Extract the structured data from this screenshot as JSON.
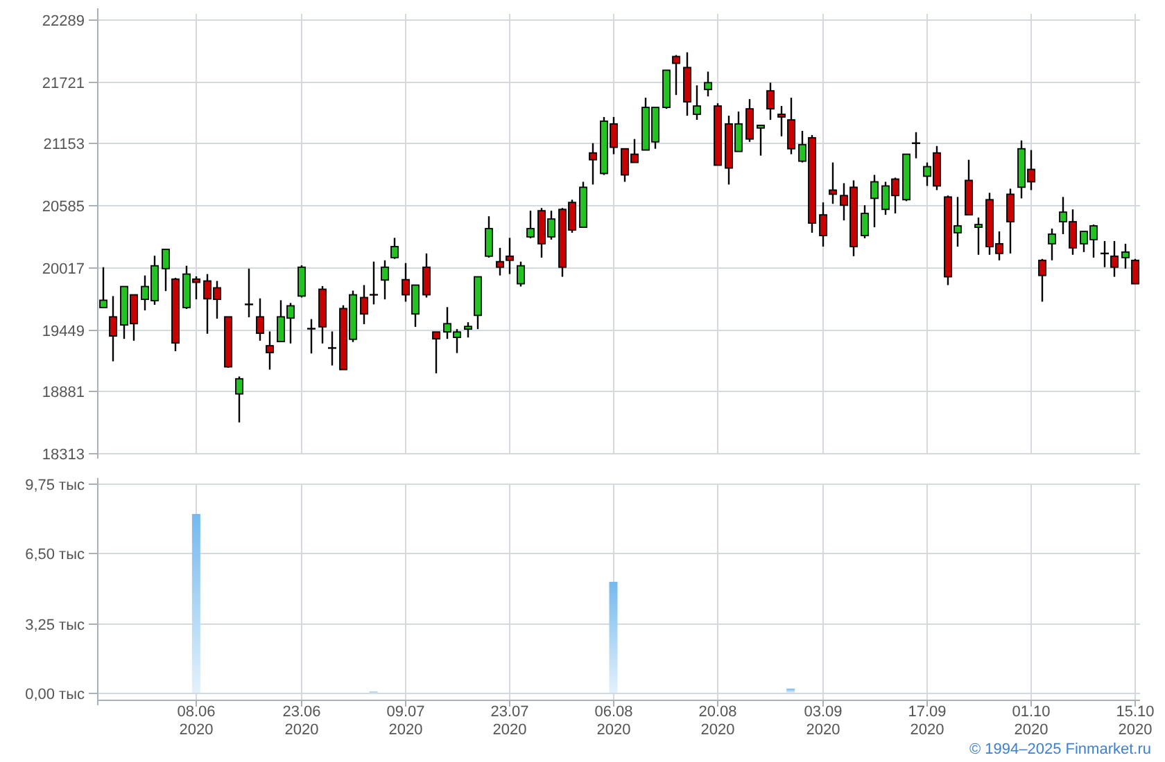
{
  "price_chart": {
    "chart_data": {
      "type": "candlestick",
      "grid": true,
      "categories": [
        null,
        null,
        null,
        null,
        null,
        null,
        null,
        null,
        null,
        null,
        null,
        null,
        null,
        null,
        null,
        null,
        null,
        null,
        null,
        null,
        null,
        null,
        null,
        null,
        null,
        null,
        null,
        null,
        null,
        null,
        null,
        null,
        null,
        null,
        null,
        null,
        null,
        null,
        null,
        null,
        null,
        null,
        null,
        null,
        null,
        null,
        null,
        null,
        null,
        null,
        null,
        null,
        null,
        null,
        null,
        null,
        null,
        null,
        null,
        null,
        null,
        null,
        null,
        null,
        null,
        null,
        null,
        null,
        null,
        null,
        null,
        null,
        null,
        null,
        null,
        null,
        null,
        null,
        null,
        null,
        null,
        null,
        null,
        null,
        null,
        null,
        null,
        null,
        null,
        null,
        null,
        null,
        null,
        null,
        null,
        null,
        null,
        null,
        null,
        null
      ],
      "ylim": [
        18313,
        22289
      ],
      "yticks": [
        18313,
        18881,
        19449,
        20017,
        20585,
        21153,
        21721,
        22289
      ],
      "ohlc": [
        [
          19647,
          20017,
          19647,
          19714
        ],
        [
          19562,
          19752,
          19154,
          19386
        ],
        [
          19487,
          19840,
          19360,
          19840
        ],
        [
          19764,
          19764,
          19343,
          19499
        ],
        [
          19722,
          19941,
          19621,
          19840
        ],
        [
          19710,
          20122,
          19672,
          20030
        ],
        [
          20004,
          20181,
          19798,
          20181
        ],
        [
          19908,
          19920,
          19247,
          19322
        ],
        [
          19647,
          20030,
          19634,
          19954
        ],
        [
          19908,
          19933,
          19722,
          19878
        ],
        [
          19891,
          19954,
          19407,
          19727
        ],
        [
          19828,
          19891,
          19545,
          19722
        ],
        [
          19562,
          19562,
          19095,
          19103
        ],
        [
          18855,
          19015,
          18594,
          18994
        ],
        [
          19676,
          20004,
          19558,
          19676
        ],
        [
          19562,
          19731,
          19343,
          19411
        ],
        [
          19297,
          19428,
          19078,
          19234
        ],
        [
          19335,
          19714,
          19335,
          19562
        ],
        [
          19550,
          19689,
          19318,
          19663
        ],
        [
          19752,
          20034,
          19739,
          20017
        ],
        [
          19453,
          19541,
          19226,
          19453
        ],
        [
          19815,
          19844,
          19318,
          19470
        ],
        [
          19276,
          19428,
          19116,
          19276
        ],
        [
          19638,
          19668,
          19078,
          19078
        ],
        [
          19356,
          19802,
          19331,
          19764
        ],
        [
          19739,
          19853,
          19495,
          19588
        ],
        [
          19764,
          20068,
          19676,
          19764
        ],
        [
          19899,
          20080,
          19722,
          20017
        ],
        [
          20105,
          20286,
          20093,
          20206
        ],
        [
          19903,
          20055,
          19701,
          19764
        ],
        [
          19588,
          19853,
          19470,
          19853
        ],
        [
          20017,
          20143,
          19739,
          19764
        ],
        [
          19423,
          19423,
          19044,
          19360
        ],
        [
          19423,
          19651,
          19360,
          19499
        ],
        [
          19373,
          19449,
          19230,
          19423
        ],
        [
          19449,
          19512,
          19373,
          19474
        ],
        [
          19575,
          19929,
          19449,
          19929
        ],
        [
          20118,
          20484,
          20105,
          20371
        ],
        [
          20068,
          20194,
          19941,
          20017
        ],
        [
          20118,
          20286,
          19954,
          20080
        ],
        [
          19865,
          20068,
          19840,
          20030
        ],
        [
          20295,
          20535,
          20282,
          20371
        ],
        [
          20535,
          20560,
          20105,
          20232
        ],
        [
          20295,
          20535,
          20270,
          20459
        ],
        [
          20547,
          20560,
          19929,
          20017
        ],
        [
          20611,
          20636,
          20333,
          20358
        ],
        [
          20383,
          20800,
          20383,
          20750
        ],
        [
          21065,
          21154,
          20775,
          21002
        ],
        [
          20876,
          21394,
          20863,
          21356
        ],
        [
          21331,
          21394,
          21053,
          21116
        ],
        [
          21103,
          21103,
          20800,
          20863
        ],
        [
          21053,
          21192,
          20977,
          20977
        ],
        [
          21091,
          21571,
          21091,
          21482
        ],
        [
          21166,
          21482,
          21103,
          21482
        ],
        [
          21482,
          21823,
          21469,
          21823
        ],
        [
          21949,
          21962,
          21596,
          21886
        ],
        [
          21848,
          21987,
          21406,
          21533
        ],
        [
          21419,
          21684,
          21368,
          21495
        ],
        [
          21646,
          21810,
          21583,
          21709
        ],
        [
          21495,
          21520,
          20952,
          20952
        ],
        [
          21331,
          21406,
          20775,
          20926
        ],
        [
          21078,
          21444,
          21078,
          21331
        ],
        [
          21469,
          21558,
          21166,
          21192
        ],
        [
          21293,
          21318,
          21040,
          21318
        ],
        [
          21634,
          21709,
          21368,
          21469
        ],
        [
          21419,
          21495,
          21217,
          21394
        ],
        [
          21368,
          21571,
          21053,
          21103
        ],
        [
          20989,
          21267,
          20977,
          21141
        ],
        [
          21204,
          21229,
          20333,
          20421
        ],
        [
          20497,
          20611,
          20206,
          20307
        ],
        [
          20724,
          20977,
          20598,
          20686
        ],
        [
          20674,
          20787,
          20446,
          20585
        ],
        [
          20750,
          20813,
          20118,
          20206
        ],
        [
          20307,
          20585,
          20282,
          20510
        ],
        [
          20648,
          20863,
          20383,
          20800
        ],
        [
          20547,
          20800,
          20497,
          20762
        ],
        [
          20825,
          20838,
          20510,
          20674
        ],
        [
          20636,
          21053,
          20623,
          21053
        ],
        [
          21154,
          21255,
          21015,
          21154
        ],
        [
          20851,
          20977,
          20762,
          20939
        ],
        [
          21065,
          21128,
          20724,
          20762
        ],
        [
          20661,
          20674,
          19853,
          19929
        ],
        [
          20333,
          20661,
          20206,
          20396
        ],
        [
          20813,
          21002,
          20497,
          20497
        ],
        [
          20383,
          20472,
          20131,
          20408
        ],
        [
          20636,
          20699,
          20131,
          20206
        ],
        [
          20232,
          20345,
          20080,
          20143
        ],
        [
          20686,
          20737,
          20143,
          20434
        ],
        [
          20750,
          21179,
          20648,
          21103
        ],
        [
          20914,
          21091,
          20724,
          20800
        ],
        [
          20080,
          20093,
          19701,
          19941
        ],
        [
          20232,
          20371,
          20080,
          20320
        ],
        [
          20434,
          20661,
          20320,
          20522
        ],
        [
          20434,
          20547,
          20131,
          20194
        ],
        [
          20232,
          20345,
          20156,
          20345
        ],
        [
          20270,
          20408,
          20105,
          20396
        ],
        [
          20143,
          20257,
          20017,
          20143
        ],
        [
          20118,
          20257,
          19929,
          20017
        ],
        [
          20105,
          20232,
          20004,
          20156
        ],
        [
          20080,
          20093,
          19865,
          19865
        ]
      ]
    }
  },
  "volume_chart": {
    "chart_data": {
      "type": "bar",
      "grid": true,
      "ylim": [
        0,
        9.75
      ],
      "yticks": [
        {
          "value": 0,
          "label": "0,00 тыс"
        },
        {
          "value": 3.25,
          "label": "3,25 тыс"
        },
        {
          "value": 6.5,
          "label": "6,50 тыс"
        },
        {
          "value": 9.75,
          "label": "9,75 тыс"
        }
      ],
      "categories": [
        null,
        null,
        null,
        null,
        null,
        null,
        null,
        null,
        null,
        "08.06\n2020",
        null,
        null,
        null,
        null,
        null,
        null,
        null,
        null,
        null,
        "23.06\n2020",
        null,
        null,
        null,
        null,
        null,
        null,
        null,
        null,
        null,
        "09.07\n2020",
        null,
        null,
        null,
        null,
        null,
        null,
        null,
        null,
        null,
        "23.07\n2020",
        null,
        null,
        null,
        null,
        null,
        null,
        null,
        null,
        null,
        "06.08\n2020",
        null,
        null,
        null,
        null,
        null,
        null,
        null,
        null,
        null,
        "20.08\n2020",
        null,
        null,
        null,
        null,
        null,
        null,
        null,
        null,
        null,
        "03.09\n2020",
        null,
        null,
        null,
        null,
        null,
        null,
        null,
        null,
        null,
        "17.09\n2020",
        null,
        null,
        null,
        null,
        null,
        null,
        null,
        null,
        null,
        "01.10\n2020",
        null,
        null,
        null,
        null,
        null,
        null,
        null,
        null,
        null,
        "15.10\n2020"
      ],
      "values": [
        null,
        null,
        null,
        null,
        null,
        null,
        null,
        null,
        null,
        8.33,
        null,
        null,
        null,
        null,
        null,
        null,
        null,
        null,
        null,
        null,
        null,
        null,
        null,
        null,
        null,
        null,
        0.05,
        null,
        null,
        null,
        null,
        null,
        null,
        null,
        null,
        null,
        null,
        null,
        null,
        null,
        null,
        null,
        null,
        null,
        null,
        null,
        null,
        null,
        null,
        5.17,
        null,
        null,
        null,
        null,
        null,
        null,
        null,
        null,
        null,
        null,
        null,
        null,
        null,
        null,
        null,
        null,
        0.19,
        null,
        null,
        null,
        null,
        null,
        null,
        null,
        null,
        null,
        null,
        null,
        null,
        null,
        null,
        null,
        null,
        null,
        null,
        null,
        null,
        null,
        null,
        null,
        null,
        null,
        null,
        null,
        null,
        null,
        null,
        null,
        null,
        null
      ]
    }
  },
  "footer": {
    "copyright": "© 1994–2025 Finmarket.ru"
  }
}
